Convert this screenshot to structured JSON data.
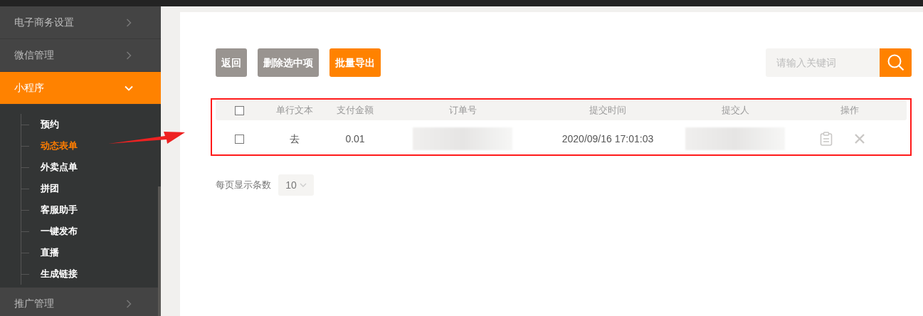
{
  "sidebar": {
    "items": [
      {
        "label": "电子商务设置",
        "selected": false,
        "expanded": false
      },
      {
        "label": "微信管理",
        "selected": false,
        "expanded": false
      },
      {
        "label": "小程序",
        "selected": true,
        "expanded": true,
        "children": [
          {
            "label": "预约",
            "selected": false
          },
          {
            "label": "动态表单",
            "selected": true
          },
          {
            "label": "外卖点单",
            "selected": false
          },
          {
            "label": "拼团",
            "selected": false
          },
          {
            "label": "客服助手",
            "selected": false
          },
          {
            "label": "一键发布",
            "selected": false
          },
          {
            "label": "直播",
            "selected": false
          },
          {
            "label": "生成链接",
            "selected": false
          }
        ]
      },
      {
        "label": "推广管理",
        "selected": false,
        "expanded": false
      }
    ]
  },
  "toolbar": {
    "buttons": [
      {
        "label": "返回",
        "kind": "secondary"
      },
      {
        "label": "删除选中项",
        "kind": "secondary"
      },
      {
        "label": "批量导出",
        "kind": "primary"
      }
    ],
    "search": {
      "placeholder": "请输入关键词"
    }
  },
  "table": {
    "header_checked": false,
    "columns": [
      "单行文本",
      "支付金额",
      "订单号",
      "提交时间",
      "提交人",
      "操作"
    ],
    "rows": [
      {
        "checked": false,
        "cells": [
          {
            "kind": "text",
            "text": "去"
          },
          {
            "kind": "text",
            "text": "0.01"
          },
          {
            "kind": "blurred"
          },
          {
            "kind": "text",
            "text": "2020/09/16 17:01:03"
          },
          {
            "kind": "blurred"
          },
          {
            "kind": "actions"
          }
        ]
      }
    ]
  },
  "pagination": {
    "label": "每页显示条数",
    "page_size": "10"
  }
}
